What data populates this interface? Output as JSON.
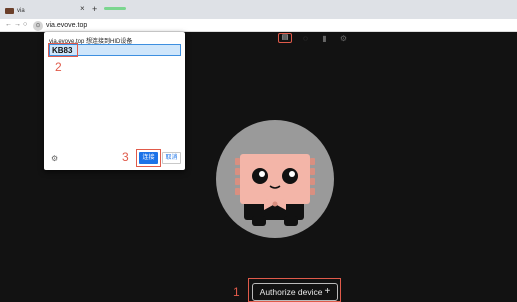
{
  "browser": {
    "tab_title": "via",
    "tab_close": "×",
    "new_tab": "+",
    "back": "←",
    "forward": "→",
    "reload": "○",
    "url": "via.evove.top"
  },
  "dialog": {
    "title": "via.evove.top 想连接到HID设备",
    "device_name": "KB83",
    "connect_label": "连接",
    "cancel_label": "取消",
    "settings_glyph": "⚙"
  },
  "markers": {
    "step1": "1",
    "step2": "2",
    "step3": "3"
  },
  "app": {
    "authorize_label": "Authorize device",
    "authorize_plus": "+",
    "icons": [
      "keyboard-icon",
      "gear-outline-icon",
      "mouse-icon",
      "settings-icon"
    ]
  },
  "colors": {
    "annotation": "#e05a4a",
    "primary": "#1a73e8",
    "background": "#121212",
    "mascot_face": "#f3b5a8",
    "mascot_circle": "#9a9a9a"
  }
}
